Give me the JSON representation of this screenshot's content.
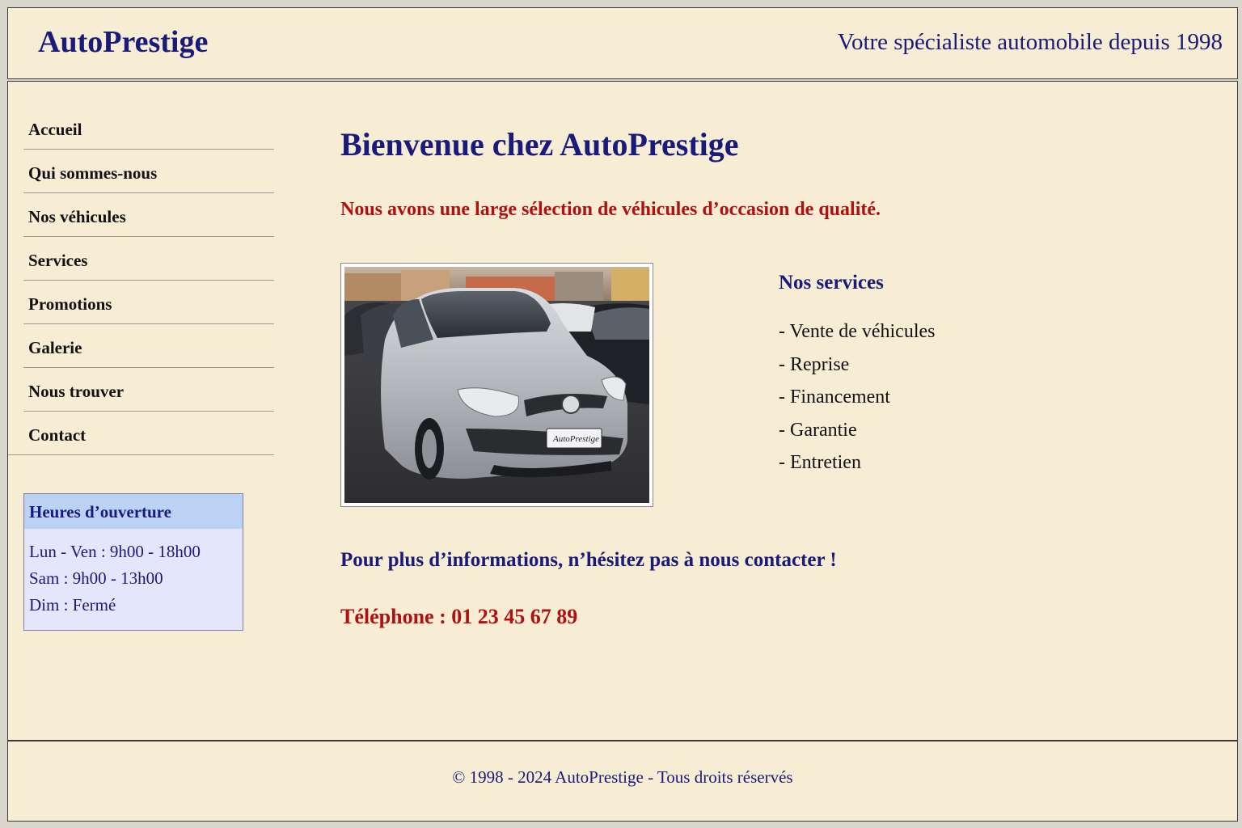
{
  "header": {
    "logo": "AutoPrestige",
    "tagline": "Votre spécialiste automobile depuis 1998"
  },
  "nav": {
    "items": [
      {
        "label": "Accueil"
      },
      {
        "label": "Qui sommes-nous"
      },
      {
        "label": "Nos véhicules"
      },
      {
        "label": "Services"
      },
      {
        "label": "Promotions"
      },
      {
        "label": "Galerie"
      },
      {
        "label": "Nous trouver"
      },
      {
        "label": "Contact"
      }
    ]
  },
  "hours": {
    "title": "Heures d’ouverture",
    "lines": [
      "Lun - Ven : 9h00 - 18h00",
      "Sam : 9h00 - 13h00",
      "Dim : Fermé"
    ]
  },
  "main": {
    "title": "Bienvenue chez AutoPrestige",
    "intro": "Nous avons une large sélection de véhicules d’occasion de qualité.",
    "photo": {
      "plate_text": "AutoPrestige"
    },
    "services_title": "Nos services",
    "services": [
      "- Vente de véhicules",
      "- Reprise",
      "- Financement",
      "- Garantie",
      "- Entretien"
    ],
    "contact_line": "Pour plus d’informations, n’hésitez pas à nous contacter !",
    "phone": "Téléphone : 01 23 45 67 89"
  },
  "footer": {
    "copyright": "© 1998 - 2024 AutoPrestige - Tous droits réservés"
  },
  "colors": {
    "page_background": "#f6edd4",
    "title_blue": "#1a1a7a",
    "accent_red": "#b01010",
    "hours_box": "#e4e6fb",
    "hours_header": "#bcd2f5"
  }
}
